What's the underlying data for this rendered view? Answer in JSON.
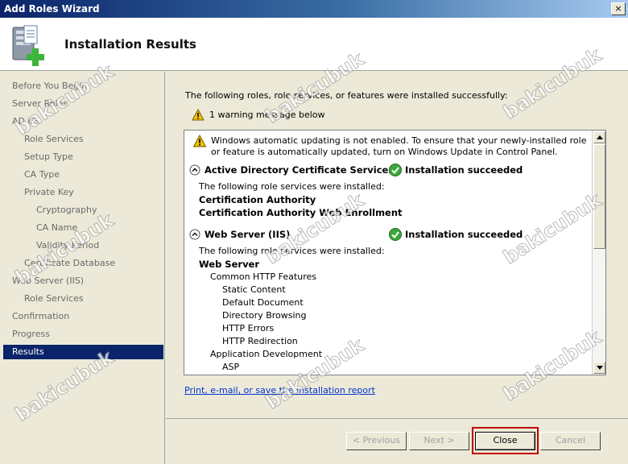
{
  "window": {
    "title": "Add Roles Wizard",
    "close_glyph": "×"
  },
  "header": {
    "title": "Installation Results",
    "icon": "server-add-icon"
  },
  "sidebar": {
    "items": [
      {
        "label": "Before You Begin",
        "level": 1
      },
      {
        "label": "Server Roles",
        "level": 1
      },
      {
        "label": "AD CS",
        "level": 1
      },
      {
        "label": "Role Services",
        "level": 2
      },
      {
        "label": "Setup Type",
        "level": 2
      },
      {
        "label": "CA Type",
        "level": 2
      },
      {
        "label": "Private Key",
        "level": 2
      },
      {
        "label": "Cryptography",
        "level": 3
      },
      {
        "label": "CA Name",
        "level": 3
      },
      {
        "label": "Validity Period",
        "level": 3
      },
      {
        "label": "Certificate Database",
        "level": 2
      },
      {
        "label": "Web Server (IIS)",
        "level": 1
      },
      {
        "label": "Role Services",
        "level": 2
      },
      {
        "label": "Confirmation",
        "level": 1
      },
      {
        "label": "Progress",
        "level": 1
      },
      {
        "label": "Results",
        "level": 1,
        "active": true
      }
    ]
  },
  "main": {
    "intro": "The following roles, role services, or features were installed successfully:",
    "warning_summary": "1 warning message below",
    "warning_text": "Windows automatic updating is not enabled. To ensure that your newly-installed role or feature is automatically updated, turn on Windows Update in Control Panel.",
    "sections": [
      {
        "name": "Active Directory Certificate Services",
        "status": "Installation succeeded",
        "intro": "The following role services were installed:",
        "items": [
          {
            "label": "Certification Authority",
            "bold": true,
            "indent": 0
          },
          {
            "label": "Certification Authority Web Enrollment",
            "bold": true,
            "indent": 0
          }
        ]
      },
      {
        "name": "Web Server (IIS)",
        "status": "Installation succeeded",
        "intro": "The following role services were installed:",
        "items": [
          {
            "label": "Web Server",
            "bold": true,
            "indent": 0
          },
          {
            "label": "Common HTTP Features",
            "bold": false,
            "indent": 1
          },
          {
            "label": "Static Content",
            "bold": false,
            "indent": 2
          },
          {
            "label": "Default Document",
            "bold": false,
            "indent": 2
          },
          {
            "label": "Directory Browsing",
            "bold": false,
            "indent": 2
          },
          {
            "label": "HTTP Errors",
            "bold": false,
            "indent": 2
          },
          {
            "label": "HTTP Redirection",
            "bold": false,
            "indent": 2
          },
          {
            "label": "Application Development",
            "bold": false,
            "indent": 1
          },
          {
            "label": "ASP",
            "bold": false,
            "indent": 2
          }
        ]
      }
    ],
    "report_link": "Print, e-mail, or save the installation report"
  },
  "buttons": {
    "previous": "< Previous",
    "next": "Next >",
    "close": "Close",
    "cancel": "Cancel"
  },
  "watermark": "bakicubuk",
  "colors": {
    "selection": "#0a246a",
    "highlight": "#c00000",
    "link": "#0033cc",
    "success": "#3aa83a",
    "warning": "#f2c200"
  }
}
